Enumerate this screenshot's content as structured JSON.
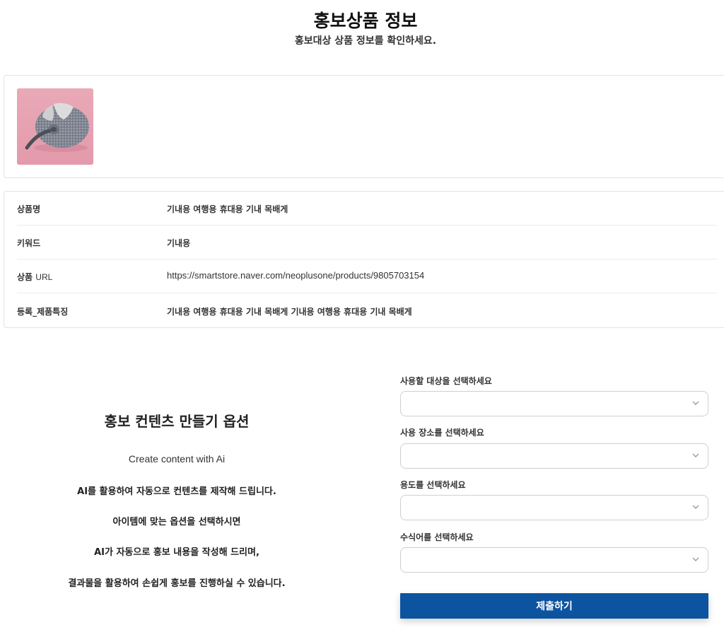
{
  "header": {
    "title": "홍보상품 정보",
    "subtitle": "홍보대상 상품 정보를 확인하세요."
  },
  "product_info": {
    "rows": [
      {
        "label": "상품명",
        "label_en": "",
        "value": "기내용 여행용 휴대용 기내 목배게"
      },
      {
        "label": "키워드",
        "label_en": "",
        "value": "기내용"
      },
      {
        "label": "상품",
        "label_en": "URL",
        "value": "https://smartstore.naver.com/neoplusone/products/9805703154"
      },
      {
        "label": "등록_제품특징",
        "label_en": "",
        "value": "기내용 여행용 휴대용 기내 목배게 기내용 여행용 휴대용 기내 목배게"
      }
    ]
  },
  "options": {
    "title": "홍보 컨텐츠 만들기 옵션",
    "intro_en": "Create content with Ai",
    "lines": [
      "AI를 활용하여 자동으로 컨텐츠를 제작해 드립니다.",
      "아이템에 맞는 옵션을 선택하시면",
      "AI가 자동으로 홍보 내용을 작성해 드리며,",
      "결과물을 활용하여 손쉽게 홍보를 진행하실 수 있습니다."
    ]
  },
  "form": {
    "fields": [
      {
        "label": "사용할 대상을 선택하세요",
        "value": ""
      },
      {
        "label": "사용 장소를 선택하세요",
        "value": ""
      },
      {
        "label": "용도를 선택하세요",
        "value": ""
      },
      {
        "label": "수식어를 선택하세요",
        "value": ""
      }
    ],
    "submit_label": "제출하기",
    "accent_color": "#0d54a0"
  },
  "icons": {
    "select_chevron": "chevron-down-icon",
    "product_image": "travel-neck-pillow-photo"
  }
}
